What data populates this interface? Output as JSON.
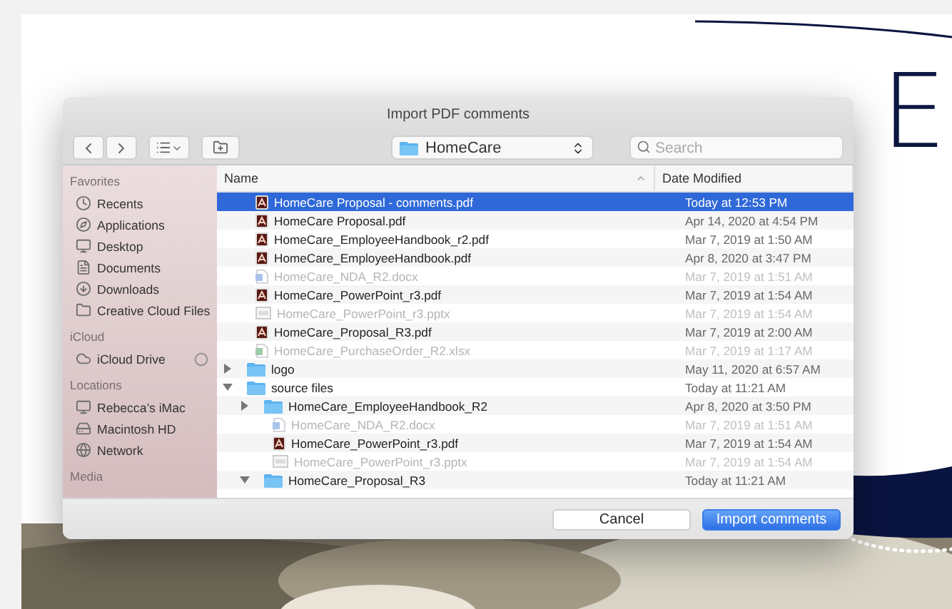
{
  "document": {
    "wordmark": "E"
  },
  "dialog": {
    "title": "Import PDF comments",
    "location": "HomeCare",
    "search": {
      "placeholder": "Search"
    },
    "sidebar": [
      {
        "heading": "Favorites",
        "items": [
          {
            "label": "Recents",
            "kind": "recents"
          },
          {
            "label": "Applications",
            "kind": "apps"
          },
          {
            "label": "Desktop",
            "kind": "desktop"
          },
          {
            "label": "Documents",
            "kind": "documents"
          },
          {
            "label": "Downloads",
            "kind": "downloads"
          },
          {
            "label": "Creative Cloud Files",
            "kind": "folder"
          }
        ]
      },
      {
        "heading": "iCloud",
        "items": [
          {
            "label": "iCloud Drive",
            "kind": "cloud",
            "syncing": true
          }
        ]
      },
      {
        "heading": "Locations",
        "items": [
          {
            "label": "Rebecca’s iMac",
            "kind": "computer"
          },
          {
            "label": "Macintosh HD",
            "kind": "disk"
          },
          {
            "label": "Network",
            "kind": "network"
          }
        ]
      },
      {
        "heading": "Media"
      }
    ],
    "columns": [
      "Name",
      "Date Modified"
    ],
    "files": [
      {
        "name": "HomeCare Proposal - comments.pdf",
        "date": "Today at 12:53 PM",
        "kind": "pdf",
        "selected": true,
        "disabled": false
      },
      {
        "name": "HomeCare Proposal.pdf",
        "date": "Apr 14, 2020 at 4:54 PM",
        "kind": "pdf",
        "selected": false,
        "disabled": false
      },
      {
        "name": "HomeCare_EmployeeHandbook_r2.pdf",
        "date": "Mar 7, 2019 at 1:50 AM",
        "kind": "pdf",
        "selected": false,
        "disabled": false
      },
      {
        "name": "HomeCare_EmployeeHandbook.pdf",
        "date": "Apr 8, 2020 at 3:47 PM",
        "kind": "pdf",
        "selected": false,
        "disabled": false
      },
      {
        "name": "HomeCare_NDA_R2.docx",
        "date": "Mar 7, 2019 at 1:51 AM",
        "kind": "docx",
        "selected": false,
        "disabled": true
      },
      {
        "name": "HomeCare_PowerPoint_r3.pdf",
        "date": "Mar 7, 2019 at 1:54 AM",
        "kind": "pdf",
        "selected": false,
        "disabled": false
      },
      {
        "name": "HomeCare_PowerPoint_r3.pptx",
        "date": "Mar 7, 2019 at 1:54 AM",
        "kind": "pptx",
        "selected": false,
        "disabled": true
      },
      {
        "name": "HomeCare_Proposal_R3.pdf",
        "date": "Mar 7, 2019 at 2:00 AM",
        "kind": "pdf",
        "selected": false,
        "disabled": false
      },
      {
        "name": "HomeCare_PurchaseOrder_R2.xlsx",
        "date": "Mar 7, 2019 at 1:17 AM",
        "kind": "xlsx",
        "selected": false,
        "disabled": true
      },
      {
        "name": "logo",
        "date": "May 11, 2020 at 6:57 AM",
        "kind": "folder",
        "selected": false,
        "disabled": false,
        "expanded": false
      },
      {
        "name": "source files",
        "date": "Today at 11:21 AM",
        "kind": "folder",
        "selected": false,
        "disabled": false,
        "expanded": true,
        "children": [
          {
            "name": "HomeCare_EmployeeHandbook_R2",
            "date": "Apr 8, 2020 at 3:50 PM",
            "kind": "folder",
            "selected": false,
            "disabled": false,
            "expanded": false
          },
          {
            "name": "HomeCare_NDA_R2.docx",
            "date": "Mar 7, 2019 at 1:51 AM",
            "kind": "docx",
            "selected": false,
            "disabled": true
          },
          {
            "name": "HomeCare_PowerPoint_r3.pdf",
            "date": "Mar 7, 2019 at 1:54 AM",
            "kind": "pdf",
            "selected": false,
            "disabled": false
          },
          {
            "name": "HomeCare_PowerPoint_r3.pptx",
            "date": "Mar 7, 2019 at 1:54 AM",
            "kind": "pptx",
            "selected": false,
            "disabled": true
          },
          {
            "name": "HomeCare_Proposal_R3",
            "date": "Today at 11:21 AM",
            "kind": "folder",
            "selected": false,
            "disabled": false,
            "expanded": true
          }
        ]
      }
    ],
    "buttons": [
      {
        "label": "Cancel",
        "kind": "secondary"
      },
      {
        "label": "Import comments",
        "kind": "primary"
      }
    ]
  }
}
